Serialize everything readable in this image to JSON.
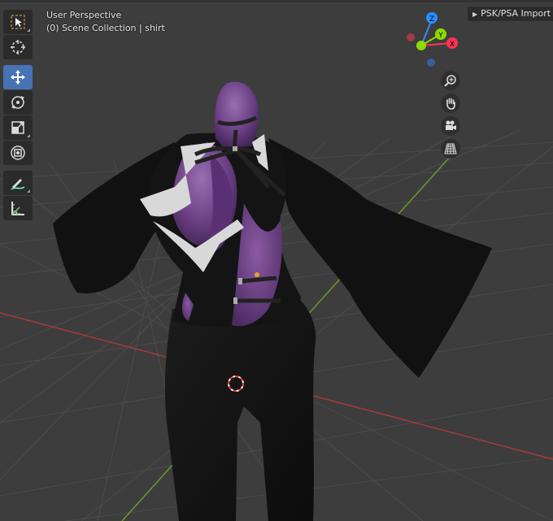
{
  "viewport": {
    "perspective_label": "User Perspective",
    "collection_label": "(0) Scene Collection | shirt"
  },
  "sidebar_tab": {
    "label": "PSK/PSA Import"
  },
  "gizmo": {
    "axis_z": "Z",
    "axis_y": "Y",
    "axis_x": "X",
    "colors": {
      "x": "#ff3352",
      "y": "#8bdc00",
      "z": "#2890ff"
    }
  },
  "toolbar": {
    "tools": [
      "select-box",
      "cursor",
      "move",
      "rotate",
      "scale",
      "transform",
      "annotate",
      "measure"
    ],
    "active_tool": "move"
  },
  "nav_buttons": [
    "zoom",
    "pan",
    "camera",
    "ortho-grid"
  ],
  "colors": {
    "background": "#3d3d3d",
    "grid": "#4a4a4a",
    "x_axis_line": "#a83a3a",
    "y_axis_line": "#6a9a2a",
    "active_tool": "#4772b3"
  }
}
